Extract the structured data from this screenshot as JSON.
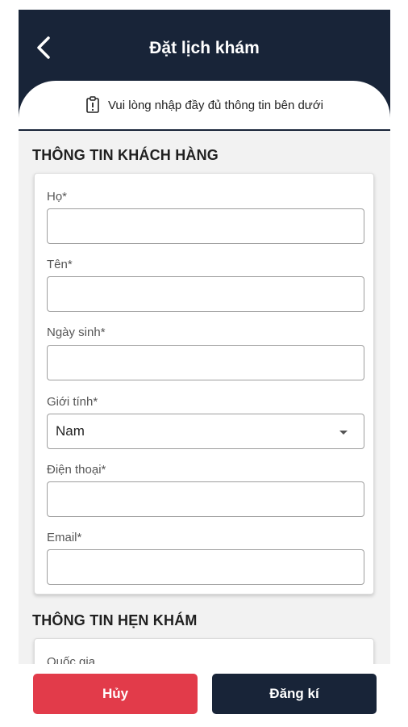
{
  "header": {
    "title": "Đặt lịch khám",
    "back_icon": "chevron-left-icon"
  },
  "notice": {
    "icon": "clipboard-alert-icon",
    "text": "Vui lòng nhập đầy đủ thông tin bên dưới"
  },
  "customer_section": {
    "title": "THÔNG TIN KHÁCH HÀNG",
    "fields": {
      "last_name": {
        "label": "Họ*",
        "value": ""
      },
      "first_name": {
        "label": "Tên*",
        "value": ""
      },
      "birthday": {
        "label": "Ngày sinh*",
        "value": ""
      },
      "gender": {
        "label": "Giới tính*",
        "value": "Nam"
      },
      "phone": {
        "label": "Điện thoại*",
        "value": ""
      },
      "email": {
        "label": "Email*",
        "value": ""
      }
    }
  },
  "appointment_section": {
    "title": "THÔNG TIN HẸN KHÁM",
    "first_field_label": "Quốc gia"
  },
  "footer": {
    "cancel_label": "Hủy",
    "submit_label": "Đăng kí"
  },
  "colors": {
    "header_bg": "#182438",
    "cancel_bg": "#e23b4a",
    "submit_bg": "#182438",
    "page_bg": "#f2f2f2"
  }
}
